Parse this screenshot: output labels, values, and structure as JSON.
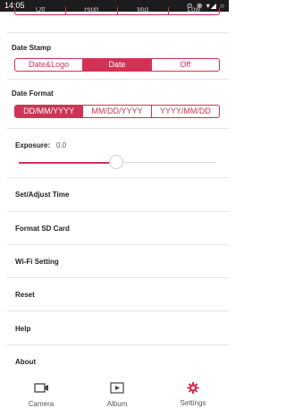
{
  "status_bar": {
    "time": "14:05",
    "icons": "⊙ ⊕ ▾◢ ○"
  },
  "quality_segment": {
    "options": [
      "Off",
      "High",
      "Mid",
      "Low"
    ]
  },
  "date_stamp": {
    "title": "Date Stamp",
    "options": [
      "Date&Logo",
      "Date",
      "Off"
    ],
    "selected": "Date"
  },
  "date_format": {
    "title": "Date Format",
    "options": [
      "DD/MM/YYYY",
      "MM/DD/YYYY",
      "YYYY/MM/DD"
    ],
    "selected": "DD/MM/YYYY"
  },
  "exposure": {
    "label": "Exposure:",
    "value": "0.0",
    "level": 0.45
  },
  "menu": [
    "Set/Adjust Time",
    "Format SD Card",
    "Wi-Fi Setting",
    "Reset",
    "Help",
    "About"
  ],
  "tabs": [
    {
      "label": "Camera",
      "icon": "video-camera-icon",
      "active": false
    },
    {
      "label": "Album",
      "icon": "play-box-icon",
      "active": false
    },
    {
      "label": "Settings",
      "icon": "gear-icon",
      "active": true
    }
  ],
  "colors": {
    "accent": "#d23355",
    "status_bar": "#1c1c1c"
  }
}
